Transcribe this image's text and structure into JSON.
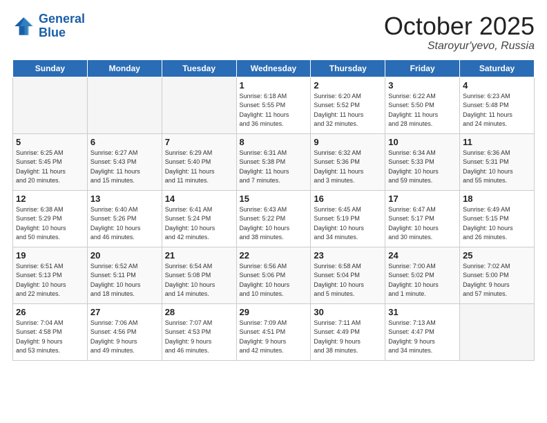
{
  "header": {
    "logo_line1": "General",
    "logo_line2": "Blue",
    "month": "October 2025",
    "location": "Staroyur'yevo, Russia"
  },
  "weekdays": [
    "Sunday",
    "Monday",
    "Tuesday",
    "Wednesday",
    "Thursday",
    "Friday",
    "Saturday"
  ],
  "weeks": [
    [
      {
        "day": "",
        "info": ""
      },
      {
        "day": "",
        "info": ""
      },
      {
        "day": "",
        "info": ""
      },
      {
        "day": "1",
        "info": "Sunrise: 6:18 AM\nSunset: 5:55 PM\nDaylight: 11 hours\nand 36 minutes."
      },
      {
        "day": "2",
        "info": "Sunrise: 6:20 AM\nSunset: 5:52 PM\nDaylight: 11 hours\nand 32 minutes."
      },
      {
        "day": "3",
        "info": "Sunrise: 6:22 AM\nSunset: 5:50 PM\nDaylight: 11 hours\nand 28 minutes."
      },
      {
        "day": "4",
        "info": "Sunrise: 6:23 AM\nSunset: 5:48 PM\nDaylight: 11 hours\nand 24 minutes."
      }
    ],
    [
      {
        "day": "5",
        "info": "Sunrise: 6:25 AM\nSunset: 5:45 PM\nDaylight: 11 hours\nand 20 minutes."
      },
      {
        "day": "6",
        "info": "Sunrise: 6:27 AM\nSunset: 5:43 PM\nDaylight: 11 hours\nand 15 minutes."
      },
      {
        "day": "7",
        "info": "Sunrise: 6:29 AM\nSunset: 5:40 PM\nDaylight: 11 hours\nand 11 minutes."
      },
      {
        "day": "8",
        "info": "Sunrise: 6:31 AM\nSunset: 5:38 PM\nDaylight: 11 hours\nand 7 minutes."
      },
      {
        "day": "9",
        "info": "Sunrise: 6:32 AM\nSunset: 5:36 PM\nDaylight: 11 hours\nand 3 minutes."
      },
      {
        "day": "10",
        "info": "Sunrise: 6:34 AM\nSunset: 5:33 PM\nDaylight: 10 hours\nand 59 minutes."
      },
      {
        "day": "11",
        "info": "Sunrise: 6:36 AM\nSunset: 5:31 PM\nDaylight: 10 hours\nand 55 minutes."
      }
    ],
    [
      {
        "day": "12",
        "info": "Sunrise: 6:38 AM\nSunset: 5:29 PM\nDaylight: 10 hours\nand 50 minutes."
      },
      {
        "day": "13",
        "info": "Sunrise: 6:40 AM\nSunset: 5:26 PM\nDaylight: 10 hours\nand 46 minutes."
      },
      {
        "day": "14",
        "info": "Sunrise: 6:41 AM\nSunset: 5:24 PM\nDaylight: 10 hours\nand 42 minutes."
      },
      {
        "day": "15",
        "info": "Sunrise: 6:43 AM\nSunset: 5:22 PM\nDaylight: 10 hours\nand 38 minutes."
      },
      {
        "day": "16",
        "info": "Sunrise: 6:45 AM\nSunset: 5:19 PM\nDaylight: 10 hours\nand 34 minutes."
      },
      {
        "day": "17",
        "info": "Sunrise: 6:47 AM\nSunset: 5:17 PM\nDaylight: 10 hours\nand 30 minutes."
      },
      {
        "day": "18",
        "info": "Sunrise: 6:49 AM\nSunset: 5:15 PM\nDaylight: 10 hours\nand 26 minutes."
      }
    ],
    [
      {
        "day": "19",
        "info": "Sunrise: 6:51 AM\nSunset: 5:13 PM\nDaylight: 10 hours\nand 22 minutes."
      },
      {
        "day": "20",
        "info": "Sunrise: 6:52 AM\nSunset: 5:11 PM\nDaylight: 10 hours\nand 18 minutes."
      },
      {
        "day": "21",
        "info": "Sunrise: 6:54 AM\nSunset: 5:08 PM\nDaylight: 10 hours\nand 14 minutes."
      },
      {
        "day": "22",
        "info": "Sunrise: 6:56 AM\nSunset: 5:06 PM\nDaylight: 10 hours\nand 10 minutes."
      },
      {
        "day": "23",
        "info": "Sunrise: 6:58 AM\nSunset: 5:04 PM\nDaylight: 10 hours\nand 5 minutes."
      },
      {
        "day": "24",
        "info": "Sunrise: 7:00 AM\nSunset: 5:02 PM\nDaylight: 10 hours\nand 1 minute."
      },
      {
        "day": "25",
        "info": "Sunrise: 7:02 AM\nSunset: 5:00 PM\nDaylight: 9 hours\nand 57 minutes."
      }
    ],
    [
      {
        "day": "26",
        "info": "Sunrise: 7:04 AM\nSunset: 4:58 PM\nDaylight: 9 hours\nand 53 minutes."
      },
      {
        "day": "27",
        "info": "Sunrise: 7:06 AM\nSunset: 4:56 PM\nDaylight: 9 hours\nand 49 minutes."
      },
      {
        "day": "28",
        "info": "Sunrise: 7:07 AM\nSunset: 4:53 PM\nDaylight: 9 hours\nand 46 minutes."
      },
      {
        "day": "29",
        "info": "Sunrise: 7:09 AM\nSunset: 4:51 PM\nDaylight: 9 hours\nand 42 minutes."
      },
      {
        "day": "30",
        "info": "Sunrise: 7:11 AM\nSunset: 4:49 PM\nDaylight: 9 hours\nand 38 minutes."
      },
      {
        "day": "31",
        "info": "Sunrise: 7:13 AM\nSunset: 4:47 PM\nDaylight: 9 hours\nand 34 minutes."
      },
      {
        "day": "",
        "info": ""
      }
    ]
  ]
}
